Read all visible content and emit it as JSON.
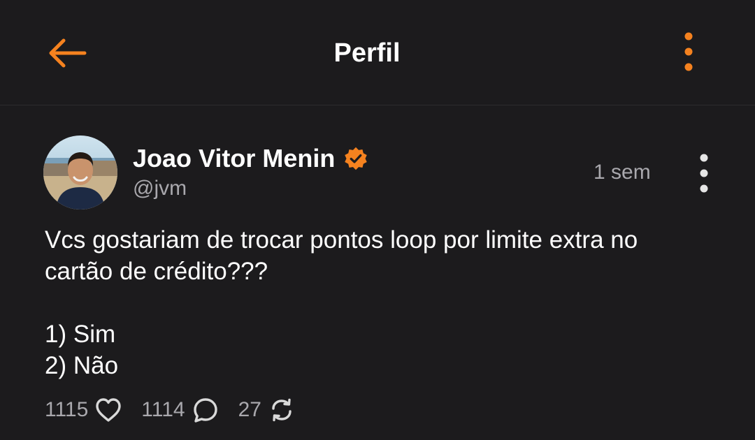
{
  "header": {
    "title": "Perfil",
    "back_icon": "arrow-left-icon",
    "menu_icon": "more-vertical-icon",
    "accent_color": "#f5821f"
  },
  "post": {
    "author_name": "Joao Vitor Menin",
    "verified_icon": "verified-badge-icon",
    "verified_color": "#f5821f",
    "handle": "@jvm",
    "time": "1 sem",
    "menu_icon": "more-vertical-icon",
    "text_line1": "Vcs gostariam de trocar pontos loop por limite extra no",
    "text_line2": "cartão de crédito???",
    "option1": "1) Sim",
    "option2": "2) Não",
    "likes": "1115",
    "like_icon": "heart-icon",
    "comments": "1114",
    "comment_icon": "comment-bubble-icon",
    "reposts": "27",
    "repost_icon": "repost-icon"
  }
}
